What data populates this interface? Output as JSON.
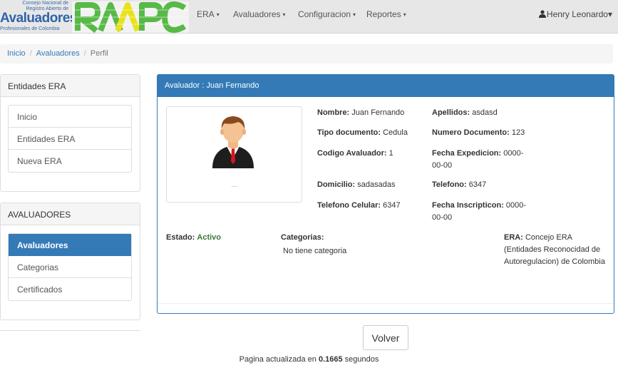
{
  "brand": {
    "line1": "Consejo Nacional de",
    "line2": "Registro Abierto de",
    "big": "Avaluadores",
    "line4": "Profesionales de Colombia",
    "logo_text": "RAAPC"
  },
  "nav": {
    "items": [
      "ERA",
      "Avaluadores",
      "Configuracion",
      "Reportes"
    ],
    "user": "Henry Leonardo"
  },
  "breadcrumb": {
    "items": [
      "Inicio",
      "Avaluadores"
    ],
    "current": "Perfil"
  },
  "sidebar": {
    "era_panel": {
      "title": "Entidades ERA",
      "items": [
        "Inicio",
        "Entidades ERA",
        "Nueva ERA"
      ]
    },
    "avaluadores_panel": {
      "title": "AVALUADORES",
      "items": [
        "Avaluadores",
        "Categorias",
        "Certificados"
      ],
      "active": "Avaluadores"
    }
  },
  "profile": {
    "header": "Avaluador : Juan Fernando",
    "photo_caption": "...",
    "nombre_label": "Nombre:",
    "nombre": "Juan Fernando",
    "apellidos_label": "Apellidos:",
    "apellidos": "asdasd",
    "tipo_doc_label": "Tipo documento:",
    "tipo_doc": "Cedula",
    "num_doc_label": "Numero Documento:",
    "num_doc": "123",
    "codigo_label": "Codigo Avaluador:",
    "codigo": "1",
    "fecha_exp_label": "Fecha Expedicion:",
    "fecha_exp": "0000-00-00",
    "domicilio_label": "Domicilio:",
    "domicilio": "sadasadas",
    "telefono_label": "Telefono:",
    "telefono": "6347",
    "celular_label": "Telefono Celular:",
    "celular": "6347",
    "fecha_ins_label": "Fecha Inscripticon:",
    "fecha_ins": "0000-00-00",
    "estado_label": "Estado:",
    "estado": "Activo",
    "categorias_label": "Categorias:",
    "categorias": "No tiene categoria",
    "era_label": "ERA:",
    "era": "Concejo ERA (Entidades Reconocidad de Autoregulacion) de Colombia"
  },
  "footer": {
    "volver_label": "Volver",
    "pagina_prefix": "Pagina actualizada en",
    "pagina_time": "0.1665",
    "pagina_suffix": "segundos"
  },
  "colors": {
    "primary": "#337ab7",
    "navbar_bg": "#e7e7e7",
    "logo_green": "#57b946",
    "logo_yellow": "#e9e21a",
    "estado_active": "#3c763d"
  }
}
